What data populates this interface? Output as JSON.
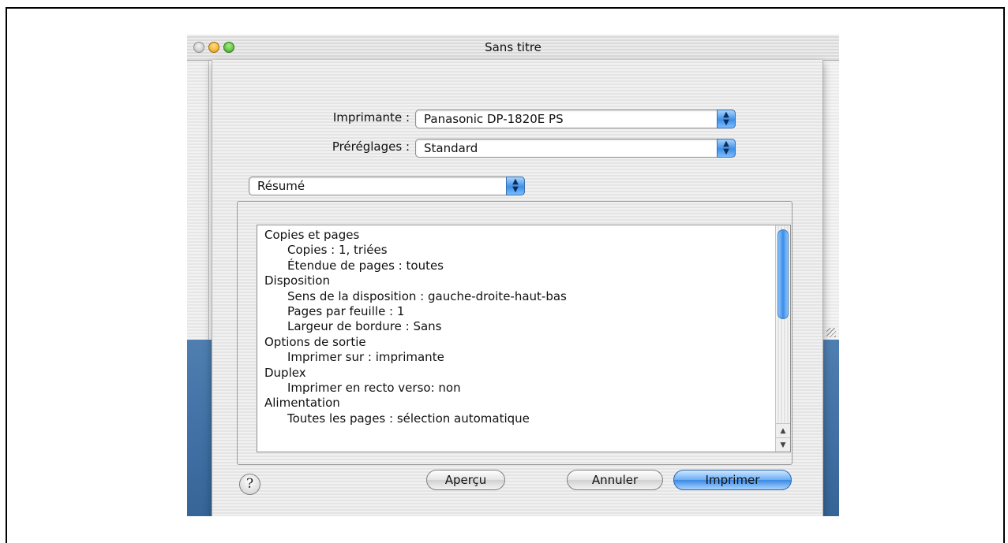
{
  "window": {
    "title": "Sans titre"
  },
  "printer": {
    "label": "Imprimante :",
    "value": "Panasonic DP-1820E PS"
  },
  "presets": {
    "label": "Préréglages :",
    "value": "Standard"
  },
  "panel": {
    "value": "Résumé"
  },
  "summary": {
    "lines": [
      {
        "kind": "heading",
        "text": "Copies et pages"
      },
      {
        "kind": "item",
        "text": "Copies :  1, triées"
      },
      {
        "kind": "item",
        "text": "Étendue de pages :  toutes"
      },
      {
        "kind": "heading",
        "text": "Disposition"
      },
      {
        "kind": "item",
        "text": "Sens de la disposition :  gauche-droite-haut-bas"
      },
      {
        "kind": "item",
        "text": "Pages par feuille :  1"
      },
      {
        "kind": "item",
        "text": "Largeur de bordure :  Sans"
      },
      {
        "kind": "heading",
        "text": "Options de sortie"
      },
      {
        "kind": "item",
        "text": "Imprimer sur :  imprimante"
      },
      {
        "kind": "heading",
        "text": "Duplex"
      },
      {
        "kind": "item",
        "text": "Imprimer en recto verso:  non"
      },
      {
        "kind": "heading",
        "text": "Alimentation"
      },
      {
        "kind": "item",
        "text": "Toutes les pages : sélection automatique"
      }
    ]
  },
  "buttons": {
    "help": "?",
    "preview": "Aperçu",
    "cancel": "Annuler",
    "print": "Imprimer"
  },
  "icons": {
    "popup_arrows": "up-down-arrows-icon",
    "scroll_up": "scroll-up-arrow-icon",
    "scroll_down": "scroll-down-arrow-icon"
  },
  "colors": {
    "accent": "#3e8fe6",
    "desktop": "#3f6fa3"
  }
}
